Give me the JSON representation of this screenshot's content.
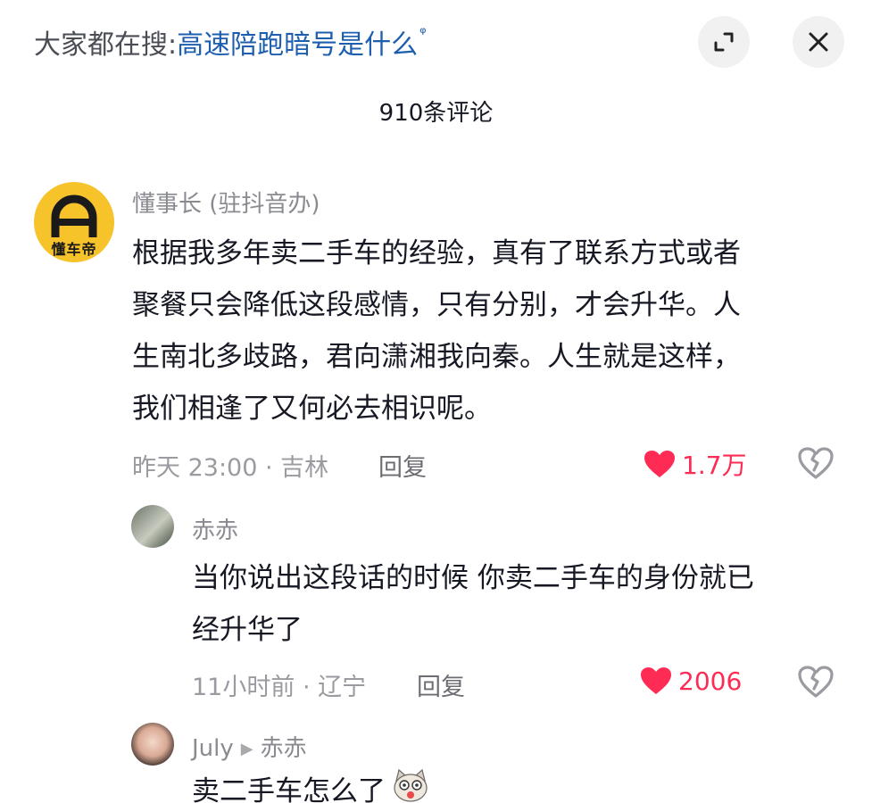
{
  "search": {
    "prefix": "大家都在搜:",
    "query": "高速陪跑暗号是什么",
    "glyph": "ᵠ"
  },
  "header": {
    "comment_count": "910条评论"
  },
  "colors": {
    "like": "#fe2c55",
    "link": "#1d5fae"
  },
  "comments": [
    {
      "author": "懂事长 (驻抖音办)",
      "avatar_text": "懂车帝",
      "lines": [
        "根据我多年卖二手车的经验，真有了联系方式或者",
        "聚餐只会降低这段感情，只有分别，才会升华。人",
        "生南北多歧路，君向潇湘我向秦。人生就是这样，",
        "我们相逢了又何必去相识呢。"
      ],
      "meta": "昨天 23:00 · 吉林",
      "reply_label": "回复",
      "likes": "1.7万",
      "liked": true
    }
  ],
  "replies": [
    {
      "author": "赤赤",
      "lines": [
        "当你说出这段话的时候 你卖二手车的身份就已",
        "经升华了"
      ],
      "meta": "11小时前 · 辽宁",
      "reply_label": "回复",
      "likes": "2006",
      "liked": true
    },
    {
      "author": "July",
      "reply_to": "赤赤",
      "lines": [
        "卖二手车怎么了"
      ]
    }
  ],
  "icons": {
    "expand": "expand-icon",
    "close": "close-icon",
    "like": "heart-icon",
    "dislike": "broken-heart-icon",
    "reply_arrow": "play-arrow-icon"
  }
}
